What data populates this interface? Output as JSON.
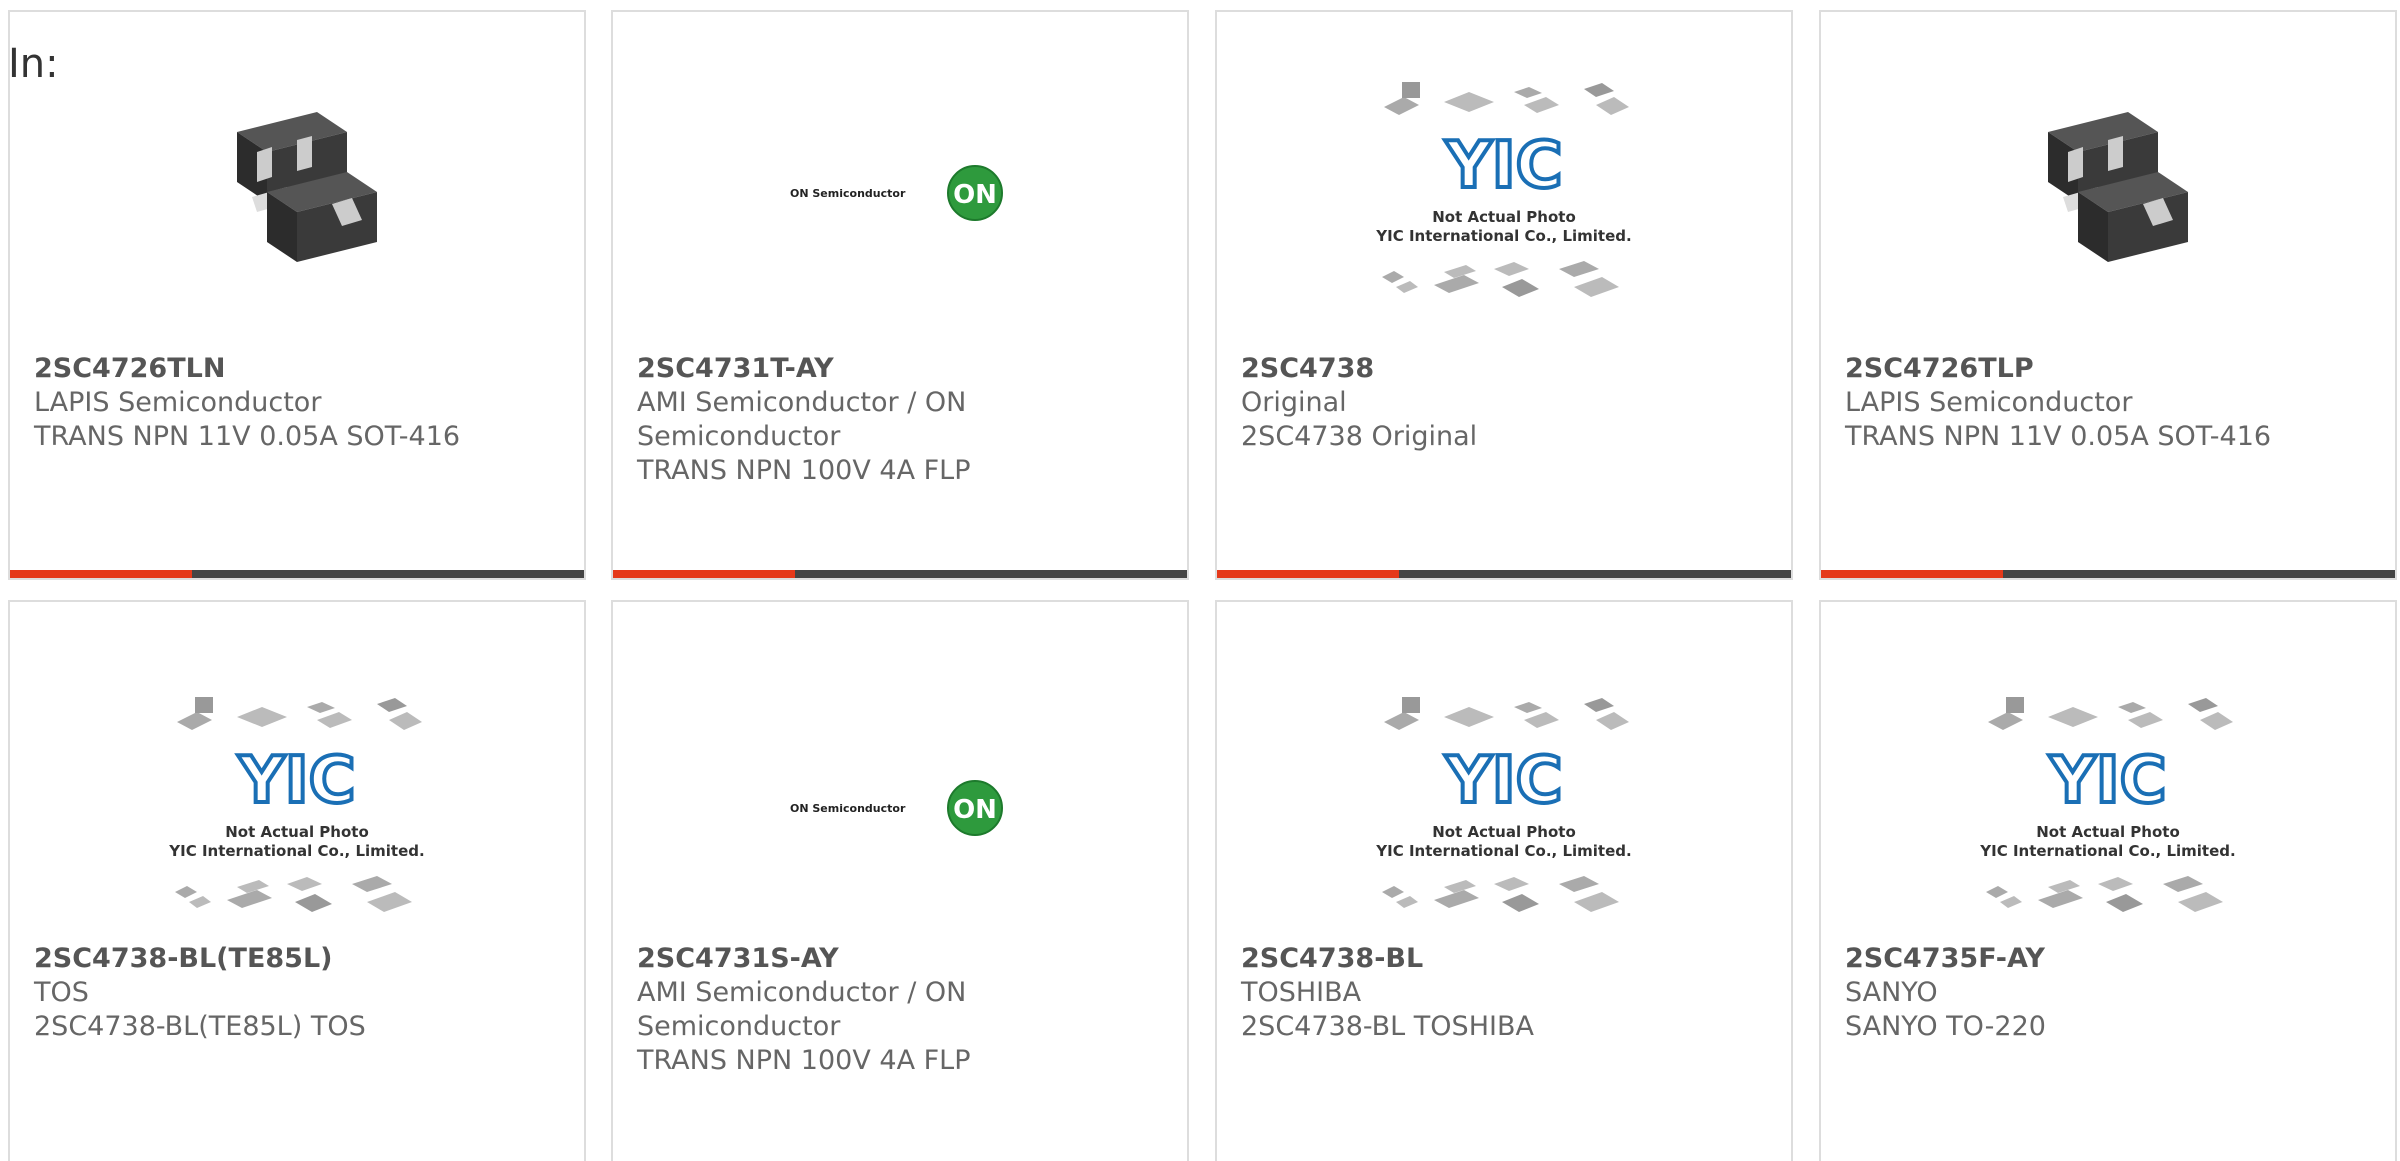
{
  "header": {
    "label": "In:"
  },
  "colors": {
    "accent": "#e5391a",
    "bar": "#444444",
    "border": "#dddddd",
    "text": "#666666"
  },
  "placeholder_image": {
    "line1": "Not Actual Photo",
    "line2": "YIC International Co., Limited.",
    "logo": "YIC"
  },
  "onsemi_logo": {
    "text": "ON Semiconductor",
    "badge": "ON"
  },
  "products": [
    {
      "part": "2SC4726TLN",
      "maker": "LAPIS Semiconductor",
      "desc": "TRANS NPN 11V 0.05A SOT-416",
      "image": "sot416-chip-photo"
    },
    {
      "part": "2SC4731T-AY",
      "maker": "AMI Semiconductor / ON Semiconductor",
      "desc": "TRANS NPN 100V 4A FLP",
      "image": "on-semiconductor-logo"
    },
    {
      "part": "2SC4738",
      "maker": "Original",
      "desc": "2SC4738 Original",
      "image": "yic-placeholder"
    },
    {
      "part": "2SC4726TLP",
      "maker": "LAPIS Semiconductor",
      "desc": "TRANS NPN 11V 0.05A SOT-416",
      "image": "sot416-chip-photo"
    },
    {
      "part": "2SC4738-BL(TE85L)",
      "maker": "TOS",
      "desc": "2SC4738-BL(TE85L) TOS",
      "image": "yic-placeholder"
    },
    {
      "part": "2SC4731S-AY",
      "maker": "AMI Semiconductor / ON Semiconductor",
      "desc": "TRANS NPN 100V 4A FLP",
      "image": "on-semiconductor-logo"
    },
    {
      "part": "2SC4738-BL",
      "maker": "TOSHIBA",
      "desc": "2SC4738-BL TOSHIBA",
      "image": "yic-placeholder"
    },
    {
      "part": "2SC4735F-AY",
      "maker": "SANYO",
      "desc": "SANYO TO-220",
      "image": "yic-placeholder"
    }
  ]
}
